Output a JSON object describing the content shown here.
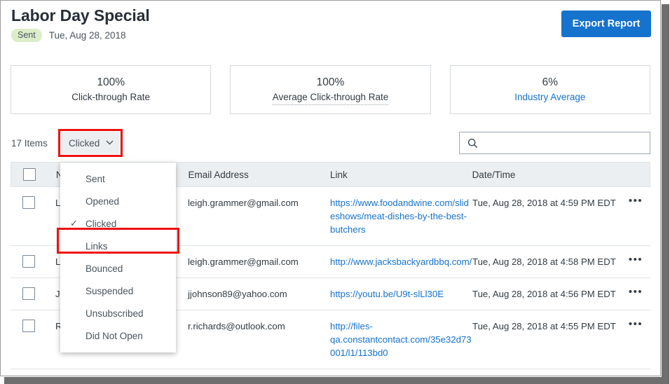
{
  "header": {
    "title": "Labor Day Special",
    "status_badge": "Sent",
    "sent_date": "Tue, Aug 28, 2018",
    "export_label": "Export Report",
    "accent_color": "#1572cd",
    "badge_color": "#dcedc9"
  },
  "stats": [
    {
      "value": "100%",
      "label": "Click-through Rate",
      "style": "plain"
    },
    {
      "value": "100%",
      "label": "Average Click-through Rate",
      "style": "dotted"
    },
    {
      "value": "6%",
      "label": "Industry Average",
      "style": "link"
    }
  ],
  "toolbar": {
    "items_count": "17 Items",
    "filter_selected": "Clicked",
    "chevron": "⌄",
    "search_value": "",
    "search_placeholder": ""
  },
  "filter_menu": {
    "items": [
      {
        "label": "Sent",
        "checked": false
      },
      {
        "label": "Opened",
        "checked": false
      },
      {
        "label": "Clicked",
        "checked": true
      },
      {
        "label": "Links",
        "checked": false
      },
      {
        "label": "Bounced",
        "checked": false
      },
      {
        "label": "Suspended",
        "checked": false
      },
      {
        "label": "Unsubscribed",
        "checked": false
      },
      {
        "label": "Did Not Open",
        "checked": false
      }
    ],
    "check_glyph": "✓",
    "highlighted_item": "Links",
    "highlight_color": "#ee1111"
  },
  "table": {
    "columns": [
      "",
      "Name",
      "Email Address",
      "Link",
      "Date/Time",
      ""
    ],
    "rows": [
      {
        "name": "Leigh Grammer",
        "email": "leigh.grammer@gmail.com",
        "link": "https://www.foodandwine.com/slideshows/meat-dishes-by-the-best-butchers",
        "datetime": "Tue, Aug 28, 2018 at 4:59 PM EDT",
        "menu": "•••"
      },
      {
        "name": "Leigh Grammer",
        "email": "leigh.grammer@gmail.com",
        "link": "http://www.jacksbackyardbbq.com/",
        "datetime": "Tue, Aug 28, 2018 at 4:58 PM EDT",
        "menu": "•••"
      },
      {
        "name": "Jim Johnson",
        "email": "jjohnson89@yahoo.com",
        "link": "https://youtu.be/U9t-slLl30E",
        "datetime": "Tue, Aug 28, 2018 at 4:56 PM EDT",
        "menu": "•••"
      },
      {
        "name": "Ricky Richards",
        "email": "r.richards@outlook.com",
        "link": "http://files-qa.constantcontact.com/35e32d73001/l1/113bd0",
        "datetime": "Tue, Aug 28, 2018 at 4:55 PM EDT",
        "menu": "•••"
      }
    ]
  }
}
